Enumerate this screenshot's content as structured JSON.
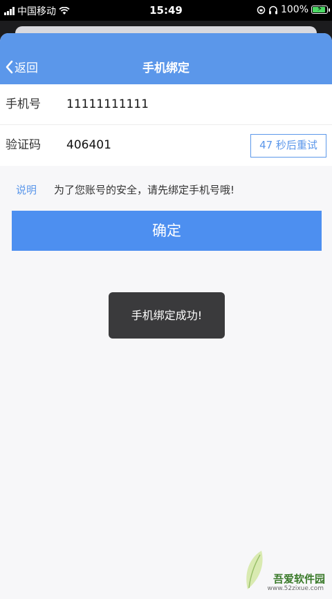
{
  "status_bar": {
    "carrier": "中国移动",
    "time": "15:49",
    "battery": "100%"
  },
  "nav": {
    "back_label": "返回",
    "title": "手机绑定"
  },
  "form": {
    "phone_label": "手机号",
    "phone_value": "11111111111",
    "code_label": "验证码",
    "code_value": "406401",
    "code_button_label": "47 秒后重试"
  },
  "note": {
    "label": "说明",
    "text": "为了您账号的安全，请先绑定手机号哦!"
  },
  "confirm_label": "确定",
  "toast": "手机绑定成功!",
  "watermark": {
    "brand": "吾爱软件园",
    "url": "www.52zixue.com"
  },
  "colors": {
    "accent": "#5b97ea",
    "button": "#4d8ff0",
    "toast_bg": "#3a3a3c"
  }
}
